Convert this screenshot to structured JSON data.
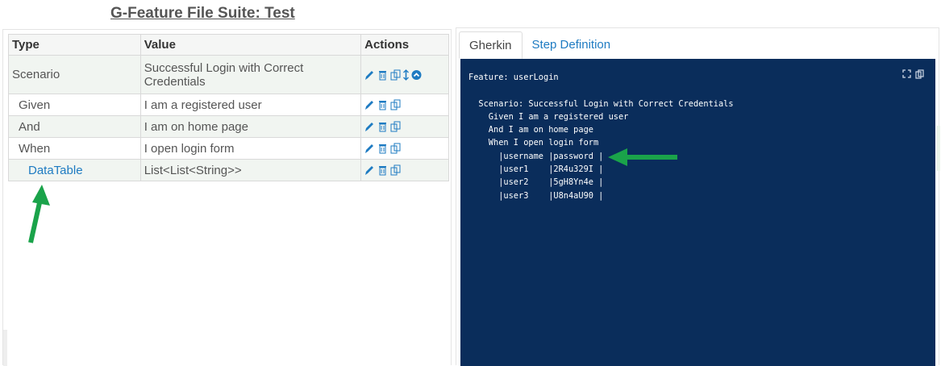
{
  "page": {
    "title": "G-Feature File Suite: Test"
  },
  "table": {
    "headers": {
      "type": "Type",
      "value": "Value",
      "actions": "Actions"
    },
    "rows": [
      {
        "type": "Scenario",
        "value": "Successful Login with Correct Credentials",
        "actions": [
          "pencil-icon",
          "trash-icon",
          "copy-icon",
          "move-vertical-icon",
          "chevron-up-circle-icon"
        ]
      },
      {
        "type": "Given",
        "value": "I am a registered user",
        "actions": [
          "pencil-icon",
          "trash-icon",
          "copy-icon"
        ]
      },
      {
        "type": "And",
        "value": "I am on home page",
        "actions": [
          "pencil-icon",
          "trash-icon",
          "copy-icon"
        ]
      },
      {
        "type": "When",
        "value": "I open login form",
        "actions": [
          "pencil-icon",
          "trash-icon",
          "copy-icon"
        ]
      },
      {
        "type": "DataTable",
        "value": "List<List<String>>",
        "actions": [
          "pencil-icon",
          "trash-icon",
          "copy-icon"
        ]
      }
    ]
  },
  "tabs": [
    {
      "label": "Gherkin",
      "active": true
    },
    {
      "label": "Step Definition",
      "active": false
    }
  ],
  "code": {
    "lines": [
      "Feature: userLogin",
      "",
      "  Scenario: Successful Login with Correct Credentials",
      "    Given I am a registered user",
      "    And I am on home page",
      "    When I open login form",
      "      |username |password |",
      "      |user1    |2R4u329I |",
      "      |user2    |5gH8Yn4e |",
      "      |user3    |U8n4aU90 |"
    ]
  },
  "colors": {
    "accent": "#1e7bc2",
    "code_bg": "#0a2d5b",
    "arrow": "#1aa34a",
    "icon_blue": "#1e7bc2"
  }
}
